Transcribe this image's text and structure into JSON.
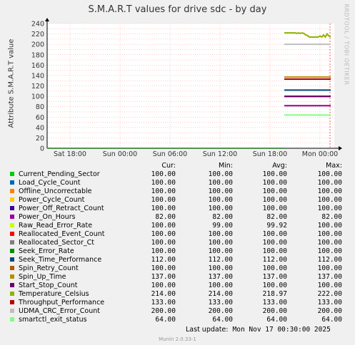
{
  "title": "S.M.A.R.T values for drive sdc - by day",
  "side_label": "RRDTOOL / TOBI OETIKER",
  "legend_headers": {
    "cur": "Cur:",
    "min": "Min:",
    "avg": "Avg:",
    "max": "Max:"
  },
  "last_update_label": "Last update:",
  "last_update_value": "Mon Nov 17 00:30:00 2025",
  "footer": "Munin 2.0.33-1",
  "colors": {
    "grid": "#ff9999",
    "axis": "#000000",
    "plot_bg": "#ffffff"
  },
  "chart_data": {
    "type": "line",
    "title": "S.M.A.R.T values for drive sdc - by day",
    "ylabel": "Attribute S.M.A.R.T value",
    "ylim": [
      0,
      240
    ],
    "yticks": [
      "0",
      "10",
      "20",
      "30",
      "40",
      "50",
      "60",
      "70",
      "80",
      "90",
      "100",
      "110",
      "120",
      "130",
      "140",
      "150",
      "160",
      "170",
      "180",
      "190",
      "200",
      "210",
      "220",
      "230",
      "240"
    ],
    "xlabels": [
      "Sat 18:00",
      "Sun 00:00",
      "Sun 06:00",
      "Sun 12:00",
      "Sun 18:00",
      "Mon 00:00"
    ],
    "grid": true,
    "series": [
      {
        "name": "Current_Pending_Sector",
        "color": "#00cc00",
        "cur": "100.00",
        "min": "100.00",
        "avg": "100.00",
        "max": "100.00"
      },
      {
        "name": "Load_Cycle_Count",
        "color": "#0066b3",
        "cur": "100.00",
        "min": "100.00",
        "avg": "100.00",
        "max": "100.00"
      },
      {
        "name": "Offline_Uncorrectable",
        "color": "#ff8000",
        "cur": "100.00",
        "min": "100.00",
        "avg": "100.00",
        "max": "100.00"
      },
      {
        "name": "Power_Cycle_Count",
        "color": "#ffcc00",
        "cur": "100.00",
        "min": "100.00",
        "avg": "100.00",
        "max": "100.00"
      },
      {
        "name": "Power_Off_Retract_Count",
        "color": "#330099",
        "cur": "100.00",
        "min": "100.00",
        "avg": "100.00",
        "max": "100.00"
      },
      {
        "name": "Power_On_Hours",
        "color": "#990099",
        "cur": "82.00",
        "min": "82.00",
        "avg": "82.00",
        "max": "82.00"
      },
      {
        "name": "Raw_Read_Error_Rate",
        "color": "#ccff00",
        "cur": "100.00",
        "min": "99.00",
        "avg": "99.92",
        "max": "100.00"
      },
      {
        "name": "Reallocated_Event_Count",
        "color": "#ff0000",
        "cur": "100.00",
        "min": "100.00",
        "avg": "100.00",
        "max": "100.00"
      },
      {
        "name": "Reallocated_Sector_Ct",
        "color": "#808080",
        "cur": "100.00",
        "min": "100.00",
        "avg": "100.00",
        "max": "100.00"
      },
      {
        "name": "Seek_Error_Rate",
        "color": "#008f00",
        "cur": "100.00",
        "min": "100.00",
        "avg": "100.00",
        "max": "100.00"
      },
      {
        "name": "Seek_Time_Performance",
        "color": "#00487d",
        "cur": "112.00",
        "min": "112.00",
        "avg": "112.00",
        "max": "112.00"
      },
      {
        "name": "Spin_Retry_Count",
        "color": "#b35a00",
        "cur": "100.00",
        "min": "100.00",
        "avg": "100.00",
        "max": "100.00"
      },
      {
        "name": "Spin_Up_Time",
        "color": "#b38f00",
        "cur": "137.00",
        "min": "137.00",
        "avg": "137.00",
        "max": "137.00"
      },
      {
        "name": "Start_Stop_Count",
        "color": "#6b006b",
        "cur": "100.00",
        "min": "100.00",
        "avg": "100.00",
        "max": "100.00"
      },
      {
        "name": "Temperature_Celsius",
        "color": "#8fb300",
        "cur": "214.00",
        "min": "214.00",
        "avg": "218.97",
        "max": "222.00"
      },
      {
        "name": "Throughput_Performance",
        "color": "#b30000",
        "cur": "133.00",
        "min": "133.00",
        "avg": "133.00",
        "max": "133.00"
      },
      {
        "name": "UDMA_CRC_Error_Count",
        "color": "#bebebe",
        "cur": "200.00",
        "min": "200.00",
        "avg": "200.00",
        "max": "200.00"
      },
      {
        "name": "smartctl_exit_status",
        "color": "#80ff80",
        "cur": "64.00",
        "min": "64.00",
        "avg": "64.00",
        "max": "64.00"
      }
    ]
  }
}
